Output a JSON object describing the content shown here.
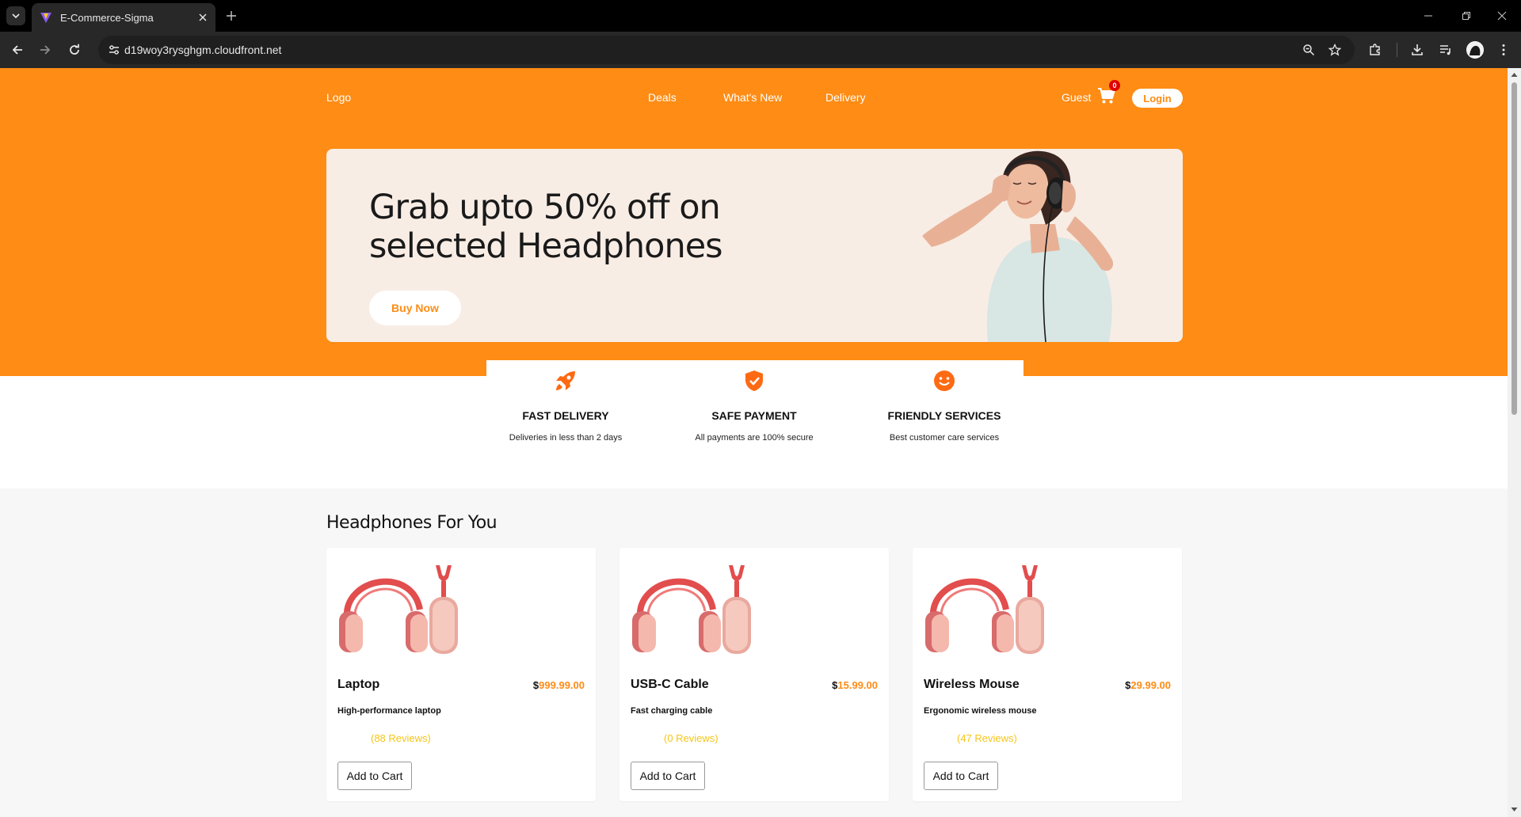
{
  "browser": {
    "tab_title": "E-Commerce-Sigma",
    "url": "d19woy3rysghgm.cloudfront.net"
  },
  "nav": {
    "logo": "Logo",
    "links": [
      "Deals",
      "What's New",
      "Delivery"
    ],
    "guest": "Guest",
    "cart_count": "0",
    "login": "Login"
  },
  "banner": {
    "title": "Grab upto 50% off on selected Headphones",
    "button": "Buy Now"
  },
  "features": [
    {
      "icon": "rocket-icon",
      "title": "FAST DELIVERY",
      "desc": "Deliveries in less than 2 days"
    },
    {
      "icon": "shield-check-icon",
      "title": "SAFE PAYMENT",
      "desc": "All payments are 100% secure"
    },
    {
      "icon": "smiley-icon",
      "title": "FRIENDLY SERVICES",
      "desc": "Best customer care services"
    }
  ],
  "products_section": {
    "title": "Headphones For You",
    "items": [
      {
        "name": "Laptop",
        "currency": "$",
        "price": "999.99.00",
        "desc": "High-performance laptop",
        "reviews": "(88 Reviews)",
        "button": "Add to Cart"
      },
      {
        "name": "USB-C Cable",
        "currency": "$",
        "price": "15.99.00",
        "desc": "Fast charging cable",
        "reviews": "(0 Reviews)",
        "button": "Add to Cart"
      },
      {
        "name": "Wireless Mouse",
        "currency": "$",
        "price": "29.99.00",
        "desc": "Ergonomic wireless mouse",
        "reviews": "(47 Reviews)",
        "button": "Add to Cart"
      }
    ]
  },
  "colors": {
    "brand_orange": "#fe8c15",
    "banner_bg": "#f8ede5",
    "review_yellow": "#f5c518",
    "badge_red": "#e00000"
  }
}
